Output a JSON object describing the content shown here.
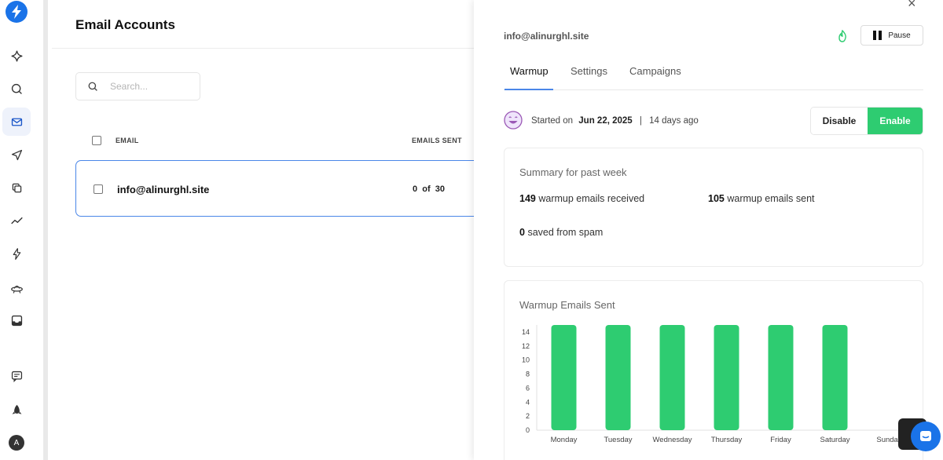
{
  "sidebar": {
    "items": [
      {
        "icon": "sparkle-icon",
        "active": false
      },
      {
        "icon": "search-icon",
        "active": false
      },
      {
        "icon": "mail-icon",
        "active": true
      },
      {
        "icon": "send-icon",
        "active": false
      },
      {
        "icon": "copy-icon",
        "active": false
      },
      {
        "icon": "trend-icon",
        "active": false
      },
      {
        "icon": "bolt-icon",
        "active": false
      },
      {
        "icon": "ufo-icon",
        "active": false
      },
      {
        "icon": "inbox-icon",
        "active": false
      },
      {
        "icon": "chat-icon",
        "active": false
      },
      {
        "icon": "rocket-icon",
        "active": false
      }
    ],
    "avatar_initial": "A"
  },
  "main": {
    "title": "Email Accounts",
    "search_placeholder": "Search...",
    "columns": {
      "email": "EMAIL",
      "emails_sent": "EMAILS SENT"
    },
    "rows": [
      {
        "email": "info@alinurghl.site",
        "sent": "0",
        "of_label": "of",
        "limit": "30"
      }
    ]
  },
  "panel": {
    "close_glyph": "×",
    "email": "info@alinurghl.site",
    "pause_label": "Pause",
    "tabs": [
      "Warmup",
      "Settings",
      "Campaigns"
    ],
    "active_tab": "Warmup",
    "started_label": "Started on",
    "started_date": "Jun 22, 2025",
    "separator": "|",
    "days_ago": "14 days ago",
    "disable_label": "Disable",
    "enable_label": "Enable",
    "summary": {
      "title": "Summary for past week",
      "received_count": "149",
      "received_label": "warmup emails received",
      "sent_count": "105",
      "sent_label": "warmup emails sent",
      "spam_count": "0",
      "spam_label": "saved from spam"
    },
    "chart_title": "Warmup Emails Sent"
  },
  "chart_data": {
    "type": "bar",
    "title": "Warmup Emails Sent",
    "categories": [
      "Monday",
      "Tuesday",
      "Wednesday",
      "Thursday",
      "Friday",
      "Saturday",
      "Sunday"
    ],
    "values": [
      15,
      15,
      15,
      15,
      15,
      15,
      0
    ],
    "yticks": [
      0,
      2,
      4,
      6,
      8,
      10,
      12,
      14
    ],
    "ylim": [
      0,
      15
    ],
    "grid": false,
    "color": "#2ecc71"
  },
  "colors": {
    "accent": "#4a86e8",
    "brand": "#1a73e8",
    "enable": "#2ecc71"
  }
}
